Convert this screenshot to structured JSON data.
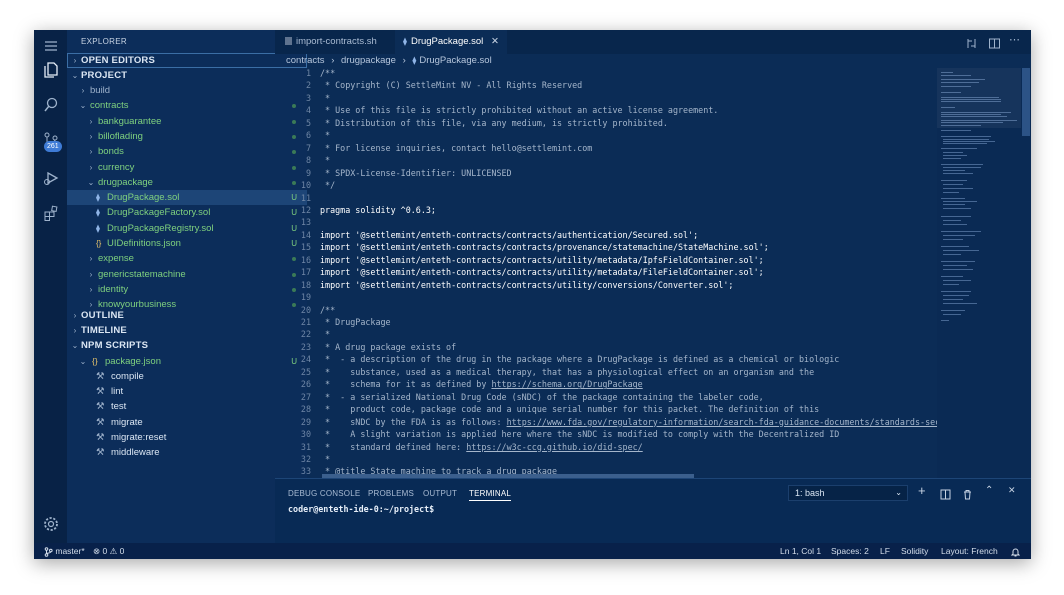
{
  "activity_bar": {
    "scm_badge": "261"
  },
  "sidebar": {
    "title": "EXPLORER",
    "sections": {
      "open_editors": "OPEN EDITORS",
      "project": "PROJECT",
      "outline": "OUTLINE",
      "timeline": "TIMELINE",
      "npm_scripts": "NPM SCRIPTS"
    },
    "tree": [
      {
        "label": "build",
        "kind": "folder",
        "depth": 1,
        "open": false,
        "status": ""
      },
      {
        "label": "contracts",
        "kind": "folder",
        "depth": 1,
        "open": true,
        "status": "dot"
      },
      {
        "label": "bankguarantee",
        "kind": "folder",
        "depth": 2,
        "open": false,
        "status": "dot"
      },
      {
        "label": "billoflading",
        "kind": "folder",
        "depth": 2,
        "open": false,
        "status": "dot"
      },
      {
        "label": "bonds",
        "kind": "folder",
        "depth": 2,
        "open": false,
        "status": "dot"
      },
      {
        "label": "currency",
        "kind": "folder",
        "depth": 2,
        "open": false,
        "status": "dot"
      },
      {
        "label": "drugpackage",
        "kind": "folder",
        "depth": 2,
        "open": true,
        "status": "dot"
      },
      {
        "label": "DrugPackage.sol",
        "kind": "sol",
        "depth": 3,
        "status": "U"
      },
      {
        "label": "DrugPackageFactory.sol",
        "kind": "sol",
        "depth": 3,
        "status": "U"
      },
      {
        "label": "DrugPackageRegistry.sol",
        "kind": "sol",
        "depth": 3,
        "status": "U"
      },
      {
        "label": "UIDefinitions.json",
        "kind": "json",
        "depth": 3,
        "status": "U"
      },
      {
        "label": "expense",
        "kind": "folder",
        "depth": 2,
        "open": false,
        "status": "dot"
      },
      {
        "label": "genericstatemachine",
        "kind": "folder",
        "depth": 2,
        "open": false,
        "status": "dot"
      },
      {
        "label": "identity",
        "kind": "folder",
        "depth": 2,
        "open": false,
        "status": "dot"
      },
      {
        "label": "knowyourbusiness",
        "kind": "folder",
        "depth": 2,
        "open": false,
        "status": "dot"
      }
    ],
    "npm": {
      "file": "package.json",
      "file_status": "U",
      "scripts": [
        "compile",
        "lint",
        "test",
        "migrate",
        "migrate:reset",
        "middleware"
      ]
    }
  },
  "editor": {
    "tabs": [
      {
        "label": "import-contracts.sh",
        "active": false
      },
      {
        "label": "DrugPackage.sol",
        "active": true
      }
    ],
    "breadcrumb": [
      "contracts",
      "drugpackage",
      "DrugPackage.sol"
    ],
    "lines": [
      "/**",
      " * Copyright (C) SettleMint NV - All Rights Reserved",
      " *",
      " * Use of this file is strictly prohibited without an active license agreement.",
      " * Distribution of this file, via any medium, is strictly prohibited.",
      " *",
      " * For license inquiries, contact hello@settlemint.com",
      " *",
      " * SPDX-License-Identifier: UNLICENSED",
      " */",
      "",
      "pragma solidity ^0.6.3;",
      "",
      "import '@settlemint/enteth-contracts/contracts/authentication/Secured.sol';",
      "import '@settlemint/enteth-contracts/contracts/provenance/statemachine/StateMachine.sol';",
      "import '@settlemint/enteth-contracts/contracts/utility/metadata/IpfsFieldContainer.sol';",
      "import '@settlemint/enteth-contracts/contracts/utility/metadata/FileFieldContainer.sol';",
      "import '@settlemint/enteth-contracts/contracts/utility/conversions/Converter.sol';",
      "",
      "/**",
      " * DrugPackage",
      " *",
      " * A drug package exists of",
      " *  - a description of the drug in the package where a DrugPackage is defined as a chemical or biologic",
      " *    substance, used as a medical therapy, that has a physiological effect on an organism and the",
      " *    schema for it as defined by https://schema.org/DrugPackage",
      " *  - a serialized National Drug Code (sNDC) of the package containing the labeler code,",
      " *    product code, package code and a unique serial number for this packet. The definition of this",
      " *    sNDC by the FDA is as follows: https://www.fda.gov/regulatory-information/search-fda-guidance-documents/standards-sec",
      " *    A slight variation is applied here where the sNDC is modified to comply with the Decentralized ID",
      " *    standard defined here: https://w3c-ccg.github.io/did-spec/",
      " *",
      " * @title State machine to track a drug package"
    ]
  },
  "panel": {
    "tabs": [
      "DEBUG CONSOLE",
      "PROBLEMS",
      "OUTPUT",
      "TERMINAL"
    ],
    "active_tab": "TERMINAL",
    "terminal_select": "1: bash",
    "prompt": "coder@enteth-ide-0:~/project$"
  },
  "status_bar": {
    "branch": "master*",
    "errors": "0",
    "warnings": "0",
    "cursor": "Ln 1, Col 1",
    "spaces": "Spaces: 2",
    "eol": "LF",
    "language": "Solidity",
    "layout": "Layout: French"
  },
  "colors": {
    "background": "#0b2c56",
    "sidebar": "#0c2d5a",
    "untracked": "#7fd17f",
    "selection": "#1d4577"
  }
}
